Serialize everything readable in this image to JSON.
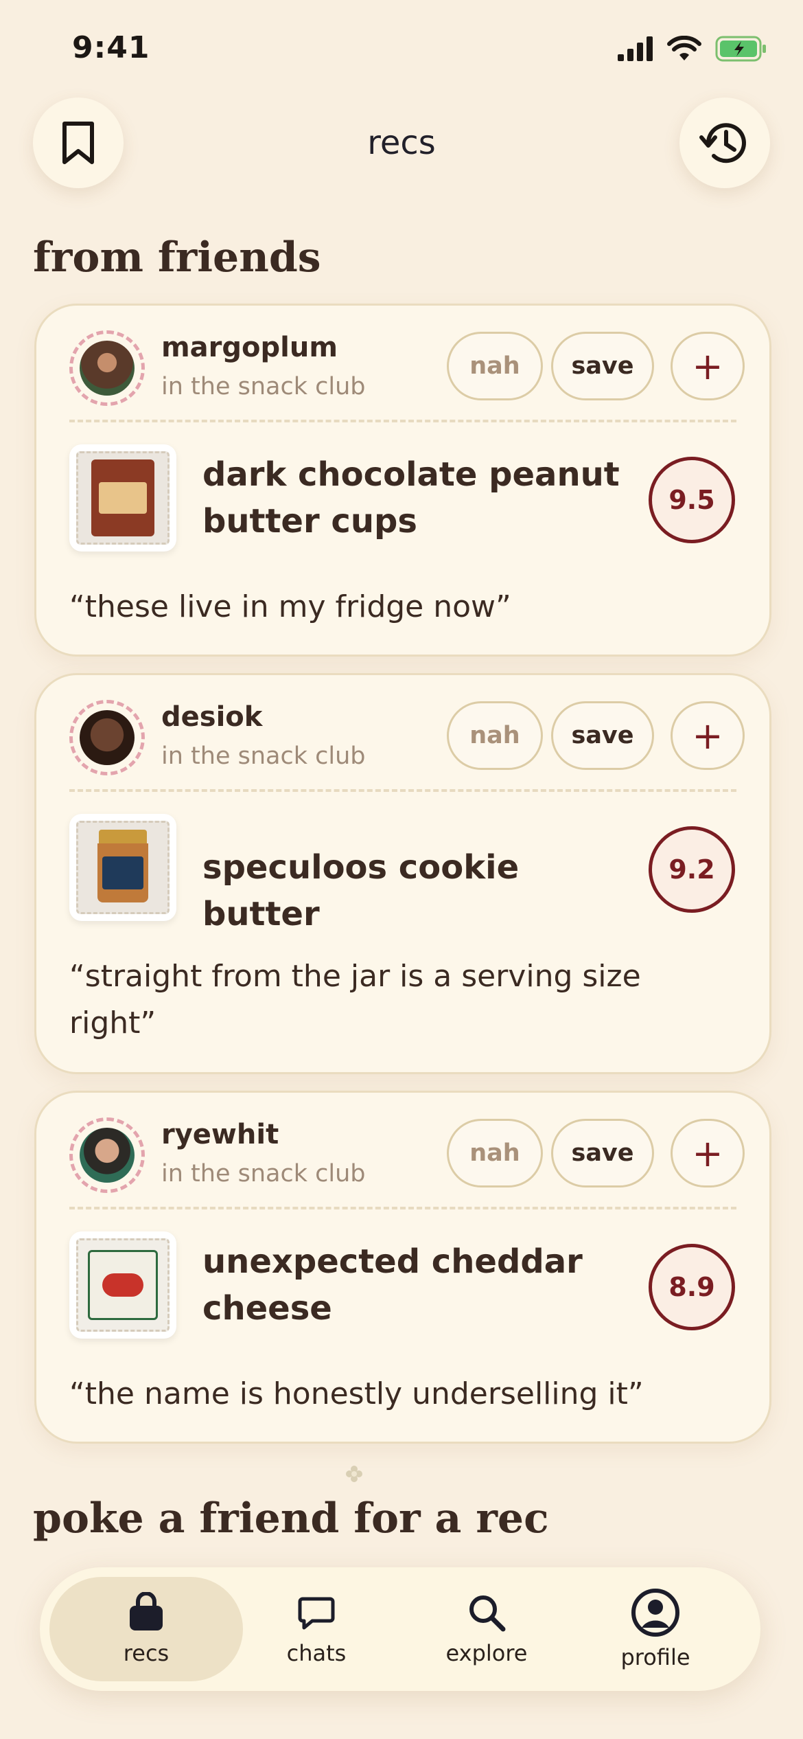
{
  "status": {
    "time": "9:41"
  },
  "header": {
    "title": "recs"
  },
  "sections": {
    "friends_title": "from friends",
    "poke_title": "poke a friend for a rec"
  },
  "cards": [
    {
      "username": "margoplum",
      "club": "in the snack club",
      "item": "dark chocolate peanut butter cups",
      "score": "9.5",
      "quote": "“these live in my fridge now”",
      "nah": "nah",
      "save": "save",
      "add": "+"
    },
    {
      "username": "desiok",
      "club": "in the snack club",
      "item": "speculoos cookie butter",
      "score": "9.2",
      "quote": "“straight from the jar is a serving size right”",
      "nah": "nah",
      "save": "save",
      "add": "+"
    },
    {
      "username": "ryewhit",
      "club": "in the snack club",
      "item": "unexpected cheddar cheese",
      "score": "8.9",
      "quote": "“the name is honestly underselling it”",
      "nah": "nah",
      "save": "save",
      "add": "+"
    }
  ],
  "nav": [
    {
      "label": "recs",
      "icon": "bag-icon",
      "active": true
    },
    {
      "label": "chats",
      "icon": "chat-bubble-icon"
    },
    {
      "label": "explore",
      "icon": "search-icon"
    },
    {
      "label": "profile",
      "icon": "person-circle-icon"
    }
  ],
  "colors": {
    "background": "#f9efe0",
    "card": "#fdf7ea",
    "accent": "#7a1d22",
    "text": "#3b2a22"
  }
}
